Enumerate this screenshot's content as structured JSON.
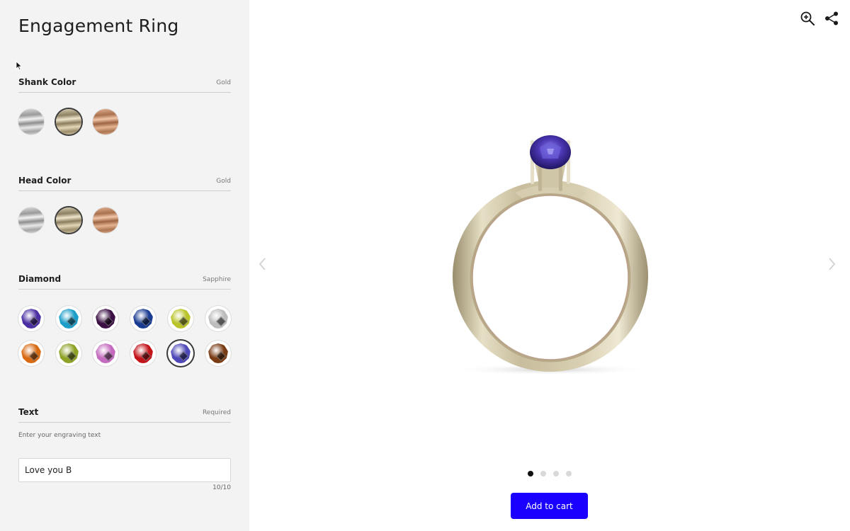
{
  "sidebar": {
    "title": "Engagement Ring",
    "shank": {
      "label": "Shank Color",
      "value": "Gold",
      "options": [
        "silver",
        "gold",
        "rose"
      ]
    },
    "head": {
      "label": "Head Color",
      "value": "Gold",
      "options": [
        "silver",
        "gold",
        "rose"
      ]
    },
    "diamond": {
      "label": "Diamond",
      "value": "Sapphire",
      "colors": [
        "#4b2fa3",
        "#1c9ec9",
        "#3c0f45",
        "#1b3c93",
        "#b9c42a",
        "#bdbdbd",
        "#d86a12",
        "#8ea226",
        "#c46bbf",
        "#c3141a",
        "#4e47b8",
        "#7a3c15"
      ]
    },
    "text": {
      "label": "Text",
      "status": "Required",
      "hint": "Enter your engraving text",
      "value": "Love you B",
      "counter": "10/10"
    }
  },
  "viewer": {
    "add_to_cart": "Add to cart",
    "dots_count": 4,
    "active_dot": 0
  },
  "colors": {
    "accent": "#1a00ff",
    "sidebar_bg": "#f3f3f3"
  }
}
